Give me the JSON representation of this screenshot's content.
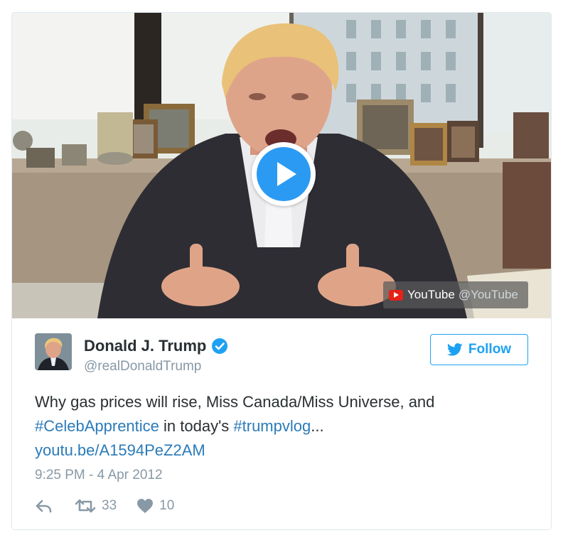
{
  "video": {
    "source_label": "YouTube",
    "source_handle": "@YouTube",
    "play_icon": "play-icon",
    "colors": {
      "play_ring": "#ffffff",
      "play_fill": "#2b9af3",
      "youtube_red": "#e62117"
    }
  },
  "tweet": {
    "display_name": "Donald J. Trump",
    "handle": "@realDonaldTrump",
    "verified_icon": "verified-badge-icon",
    "follow_label": "Follow",
    "text_part1": "Why gas prices will rise, Miss Canada/Miss Universe, and",
    "hashtag1": "#CelebApprentice",
    "text_part2": " in today's ",
    "hashtag2": "#trumpvlog",
    "text_part3": "...",
    "url": "youtu.be/A1594PeZ2AM",
    "timestamp": "9:25 PM - 4 Apr 2012",
    "retweet_count": "33",
    "like_count": "10",
    "icons": {
      "reply": "reply-icon",
      "retweet": "retweet-icon",
      "like": "heart-icon",
      "follow": "twitter-bird-icon"
    },
    "colors": {
      "link": "#2b7bb9",
      "accent": "#1da1f2",
      "muted": "#8899a6",
      "text": "#292f33"
    }
  }
}
